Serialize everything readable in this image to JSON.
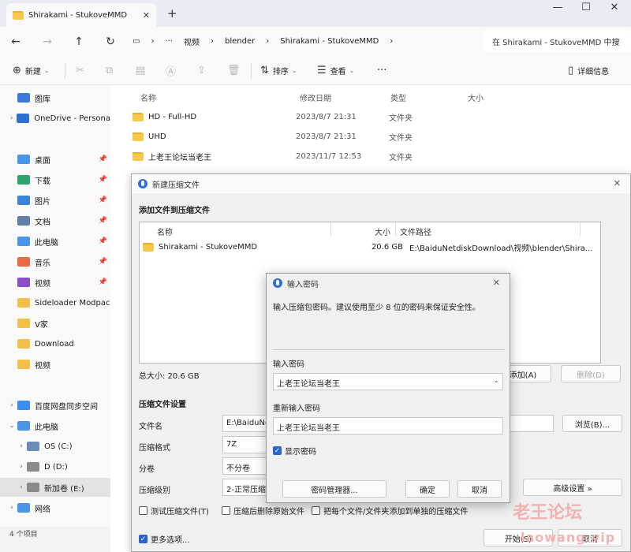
{
  "explorer": {
    "tab_title": "Shirakami - StukoveMMD",
    "tab_close": "✕",
    "new_tab": "+",
    "window_controls": [
      "—",
      "☐",
      "✕"
    ],
    "nav": {
      "back": "←",
      "forward": "→",
      "up": "↑",
      "refresh": "↻"
    },
    "breadcrumbs": [
      "视频",
      "blender",
      "Shirakami - StukoveMMD"
    ],
    "breadcrumb_more": "···",
    "search_placeholder": "在 Shirakami - StukoveMMD 中搜",
    "toolbar": {
      "new": "新建",
      "sort": "排序",
      "view": "查看",
      "more": "···",
      "details": "详细信息"
    },
    "sidebar": [
      {
        "label": "图库",
        "icon": "gallery-icon",
        "color": "#3d7bd9",
        "chev": "",
        "pin": ""
      },
      {
        "label": "OneDrive - Persona",
        "icon": "cloud-icon",
        "color": "#2f6fd1",
        "chev": "›",
        "pin": ""
      },
      {
        "label": "桌面",
        "icon": "desktop-icon",
        "color": "#4b95e6",
        "chev": "",
        "pin": "📌"
      },
      {
        "label": "下载",
        "icon": "download-icon",
        "color": "#2ea36c",
        "chev": "",
        "pin": "📌"
      },
      {
        "label": "图片",
        "icon": "pictures-icon",
        "color": "#3a86d6",
        "chev": "",
        "pin": "📌"
      },
      {
        "label": "文档",
        "icon": "documents-icon",
        "color": "#5f7fa8",
        "chev": "",
        "pin": "📌"
      },
      {
        "label": "此电脑",
        "icon": "pc-icon",
        "color": "#4b95e6",
        "chev": "",
        "pin": "📌"
      },
      {
        "label": "音乐",
        "icon": "music-icon",
        "color": "#e46b43",
        "chev": "",
        "pin": "📌"
      },
      {
        "label": "视频",
        "icon": "video-icon",
        "color": "#8a4fc7",
        "chev": "",
        "pin": "📌"
      },
      {
        "label": "Sideloader Modpac",
        "icon": "folder-icon",
        "color": "#f2c04a",
        "chev": "",
        "pin": ""
      },
      {
        "label": "V家",
        "icon": "folder-icon",
        "color": "#f2c04a",
        "chev": "",
        "pin": ""
      },
      {
        "label": "Download",
        "icon": "folder-icon",
        "color": "#f2c04a",
        "chev": "",
        "pin": ""
      },
      {
        "label": "视频",
        "icon": "folder-icon",
        "color": "#f2c04a",
        "chev": "",
        "pin": ""
      },
      {
        "label": "百度网盘同步空间",
        "icon": "baidu-cloud-icon",
        "color": "#3b8ef0",
        "chev": "›",
        "pin": ""
      },
      {
        "label": "此电脑",
        "icon": "pc-icon",
        "color": "#4b95e6",
        "chev": "⌄",
        "pin": ""
      },
      {
        "label": "OS (C:)",
        "icon": "drive-icon",
        "color": "#6b8db5",
        "chev": "›",
        "pin": ""
      },
      {
        "label": "D (D:)",
        "icon": "drive-icon",
        "color": "#8a8a8a",
        "chev": "›",
        "pin": ""
      },
      {
        "label": "新加卷 (E:)",
        "icon": "drive-icon",
        "color": "#8a8a8a",
        "chev": "›",
        "pin": ""
      },
      {
        "label": "网络",
        "icon": "network-icon",
        "color": "#4b95e6",
        "chev": "›",
        "pin": ""
      }
    ],
    "status": "4 个项目",
    "columns": {
      "name": "名称",
      "date": "修改日期",
      "type": "类型",
      "size": "大小"
    },
    "files": [
      {
        "name": "HD - Full-HD",
        "date": "2023/8/7 21:31",
        "type": "文件夹"
      },
      {
        "name": "UHD",
        "date": "2023/8/7 21:31",
        "type": "文件夹"
      },
      {
        "name": "上老王论坛当老王",
        "date": "2023/11/7 12:53",
        "type": "文件夹"
      }
    ]
  },
  "archive_dialog": {
    "title": "新建压缩文件",
    "close": "✕",
    "add_section": "添加文件到压缩文件",
    "table_headers": {
      "name": "名称",
      "size": "大小",
      "path": "文件路径"
    },
    "rows": [
      {
        "name": "Shirakami - StukoveMMD",
        "size": "20.6 GB",
        "path": "E:\\BaiduNetdiskDownload\\视频\\blender\\Shira..."
      }
    ],
    "total_size": "总大小: 20.6 GB",
    "add_button": "添加(A)",
    "delete_button": "删除(D)",
    "settings_section": "压缩文件设置",
    "filename_label": "文件名",
    "filename_value": "E:\\BaiduNe",
    "browse_button": "浏览(B)...",
    "format_label": "压缩格式",
    "format_value": "7Z",
    "split_label": "分卷",
    "split_value": "不分卷",
    "level_label": "压缩级别",
    "level_value": "2-正常压缩",
    "advanced_button": "高级设置 »",
    "test_checkbox": "测试压缩文件(T)",
    "delete_after_checkbox": "压缩后删除原始文件",
    "separate_checkbox": "把每个文件/文件夹添加到单独的压缩文件",
    "more_options": "更多选项...",
    "start_button": "开始(S)",
    "cancel_button": "取消"
  },
  "password_dialog": {
    "title": "输入密码",
    "close": "✕",
    "hint": "输入压缩包密码。建议使用至少 8 位的密码来保证安全性。",
    "password_label": "输入密码",
    "password_value": "上老王论坛当老王",
    "confirm_label": "重新输入密码",
    "confirm_value": "上老王论坛当老王",
    "show_password": "显示密码",
    "manager_button": "密码管理器...",
    "ok_button": "确定",
    "cancel_button": "取消"
  },
  "watermark": {
    "line1": "老王论坛",
    "line2": "laowang.vip"
  }
}
